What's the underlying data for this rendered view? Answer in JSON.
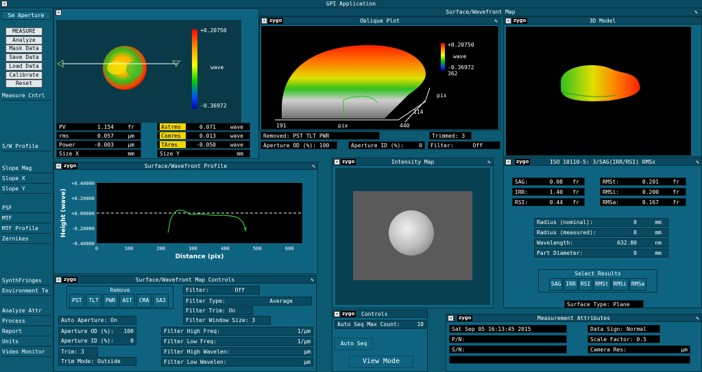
{
  "app": {
    "title": "GPI Application",
    "logo": "zygo"
  },
  "sidebar": {
    "top_button": "Sm Aperture",
    "buttons": [
      "MEASURE",
      "Analyze",
      "Mask Data",
      "Save Data",
      "Load Data",
      "Calibrate",
      "Reset"
    ],
    "items_a": [
      "Measure Cntrl"
    ],
    "items_b": [
      "S/W Profile"
    ],
    "items_c": [
      "Slope Mag",
      "Slope X",
      "Slope Y"
    ],
    "items_d": [
      "PSF",
      "MTF",
      "MTF Profile",
      "Zernikes"
    ],
    "items_e": [
      "SynthFringes",
      "Environment Te"
    ],
    "items_f": [
      "Analyze Attr",
      "Process",
      "Report",
      "Units",
      "Video Monitor"
    ]
  },
  "surface_map": {
    "title": "Surface/Wavefront Map",
    "scale_max": "+0.20750",
    "scale_unit": "wave",
    "scale_min": "-0.36972",
    "stats": [
      {
        "label": "PV",
        "value": "1.154",
        "unit": "fr"
      },
      {
        "label": "rms",
        "value": "0.057",
        "unit": "µm"
      },
      {
        "label": "Power",
        "value": "-0.003",
        "unit": "µm"
      },
      {
        "label": "Size X",
        "value": "",
        "unit": "mm"
      }
    ],
    "stats2": [
      {
        "label": "Astrms",
        "value": "0.071",
        "unit": "wave"
      },
      {
        "label": "Comrms",
        "value": "0.013",
        "unit": "wave"
      },
      {
        "label": "TArms",
        "value": "-0.050",
        "unit": "wave"
      },
      {
        "label": "Size Y",
        "value": "",
        "unit": "mm"
      }
    ]
  },
  "oblique": {
    "title": "Oblique Plot",
    "max": "+0.20750",
    "unit": "wave",
    "min": "-0.36972",
    "y_top": "362",
    "y_unit": "pix",
    "y_bottom": "114",
    "x_left": "191",
    "x_unit": "pix",
    "x_right": "440",
    "removed": "Removed: PST TLT PWR",
    "trimmed": "Trimmed: 3",
    "ap_od_label": "Aperture OD (%):",
    "ap_od": "100",
    "ap_id_label": "Aperture ID (%):",
    "ap_id": "0",
    "filter_label": "Filter:",
    "filter": "Off"
  },
  "model3d": {
    "title": "3D Model"
  },
  "profile": {
    "title": "Surface/Wavefront Profile",
    "ylabel": "Height (wave)",
    "xlabel": "Distance (pix)"
  },
  "intensity": {
    "title": "Intensity Map"
  },
  "iso": {
    "title": "ISO 10110-5: 3/SAG(IRR/RSI) RMSx",
    "left": [
      {
        "label": "SAG:",
        "value": "0.08",
        "unit": "fr"
      },
      {
        "label": "IRR:",
        "value": "1.40",
        "unit": "fr"
      },
      {
        "label": "RSI:",
        "value": "0.44",
        "unit": "fr"
      }
    ],
    "right": [
      {
        "label": "RMSt:",
        "value": "0.201",
        "unit": "fr"
      },
      {
        "label": "RMSi:",
        "value": "0.200",
        "unit": "fr"
      },
      {
        "label": "RMSa:",
        "value": "0.167",
        "unit": "fr"
      }
    ],
    "params": [
      {
        "label": "Radius (nominal):",
        "value": "0",
        "unit": "mm"
      },
      {
        "label": "Radius (measured):",
        "value": "0",
        "unit": "mm"
      },
      {
        "label": "Wavelength:",
        "value": "632.80",
        "unit": "nm"
      },
      {
        "label": "Part Diameter:",
        "value": "0",
        "unit": "mm"
      }
    ],
    "select_title": "Select Results",
    "select": [
      "SAG",
      "IRR",
      "RSI",
      "RMSt",
      "RMSi",
      "RMSa"
    ],
    "surface_type_label": "Surface Type:",
    "surface_type": "Plane"
  },
  "controls": {
    "title": "Surface/Wavefront Map Controls",
    "remove_title": "Remove",
    "remove": [
      "PST",
      "TLT",
      "PWR",
      "AST",
      "CMA",
      "SA3"
    ],
    "auto_ap_label": "Auto Aperture:",
    "auto_ap": "On",
    "ap_od_label": "Aperture OD (%):",
    "ap_od": "100",
    "ap_id_label": "Aperture ID (%):",
    "ap_id": "0",
    "trim_label": "Trim:",
    "trim": "3",
    "trim_mode_label": "Trim Mode:",
    "trim_mode": "Outside",
    "filter_label": "Filter:",
    "filter": "Off",
    "filter_type_label": "Filter Type:",
    "filter_type": "Average",
    "filter_trim_label": "Filter Trim:",
    "filter_trim": "On",
    "filter_window_label": "Filter Window Size:",
    "filter_window": "3",
    "freq": [
      {
        "label": "Filter High Freq:",
        "unit": "1/µm"
      },
      {
        "label": "Filter Low  Freq:",
        "unit": "1/µm"
      },
      {
        "label": "Filter High Wavelen:",
        "unit": "µm"
      },
      {
        "label": "Filter Low  Wavelen:",
        "unit": "µm"
      }
    ]
  },
  "seq": {
    "title": "Controls",
    "max_label": "Auto Seq Max Count:",
    "max": "10",
    "auto_seq": "Auto Seq",
    "view_mode": "View Mode"
  },
  "attrs": {
    "title": "Measurement Attributes",
    "date": "Sat Sep 05 16:13:45 2015",
    "pn": "P/N:",
    "sn": "S/N:",
    "data_sign_label": "Data Sign:",
    "data_sign": "Normal",
    "scale_label": "Scale Factor:",
    "scale": "0.5",
    "camera_label": "Camera Res:",
    "camera_unit": "µm"
  },
  "profile_chart": {
    "chart_data": {
      "type": "line",
      "ylabel": "Height (wave)",
      "xlabel": "Distance (pix)",
      "xlim": [
        0,
        640
      ],
      "ylim": [
        -0.4,
        0.4
      ],
      "xticks": [
        "0",
        "100",
        "200",
        "300",
        "400",
        "500",
        "600"
      ],
      "yticks": [
        "+0.40000",
        "+0.20000",
        "+0.00000",
        "-0.20000",
        "-0.40000"
      ],
      "x": [
        222,
        230,
        240,
        250,
        260,
        270,
        280,
        290,
        300,
        320,
        340,
        360,
        380,
        400,
        420,
        440,
        450,
        455,
        460,
        463,
        465
      ],
      "y": [
        -0.26,
        -0.08,
        0.0,
        0.03,
        0.04,
        0.03,
        0.01,
        -0.02,
        -0.02,
        -0.01,
        -0.02,
        -0.03,
        -0.03,
        -0.03,
        -0.04,
        -0.06,
        -0.1,
        -0.12,
        -0.18,
        -0.24,
        -0.18
      ],
      "dashed_zero": true
    }
  }
}
